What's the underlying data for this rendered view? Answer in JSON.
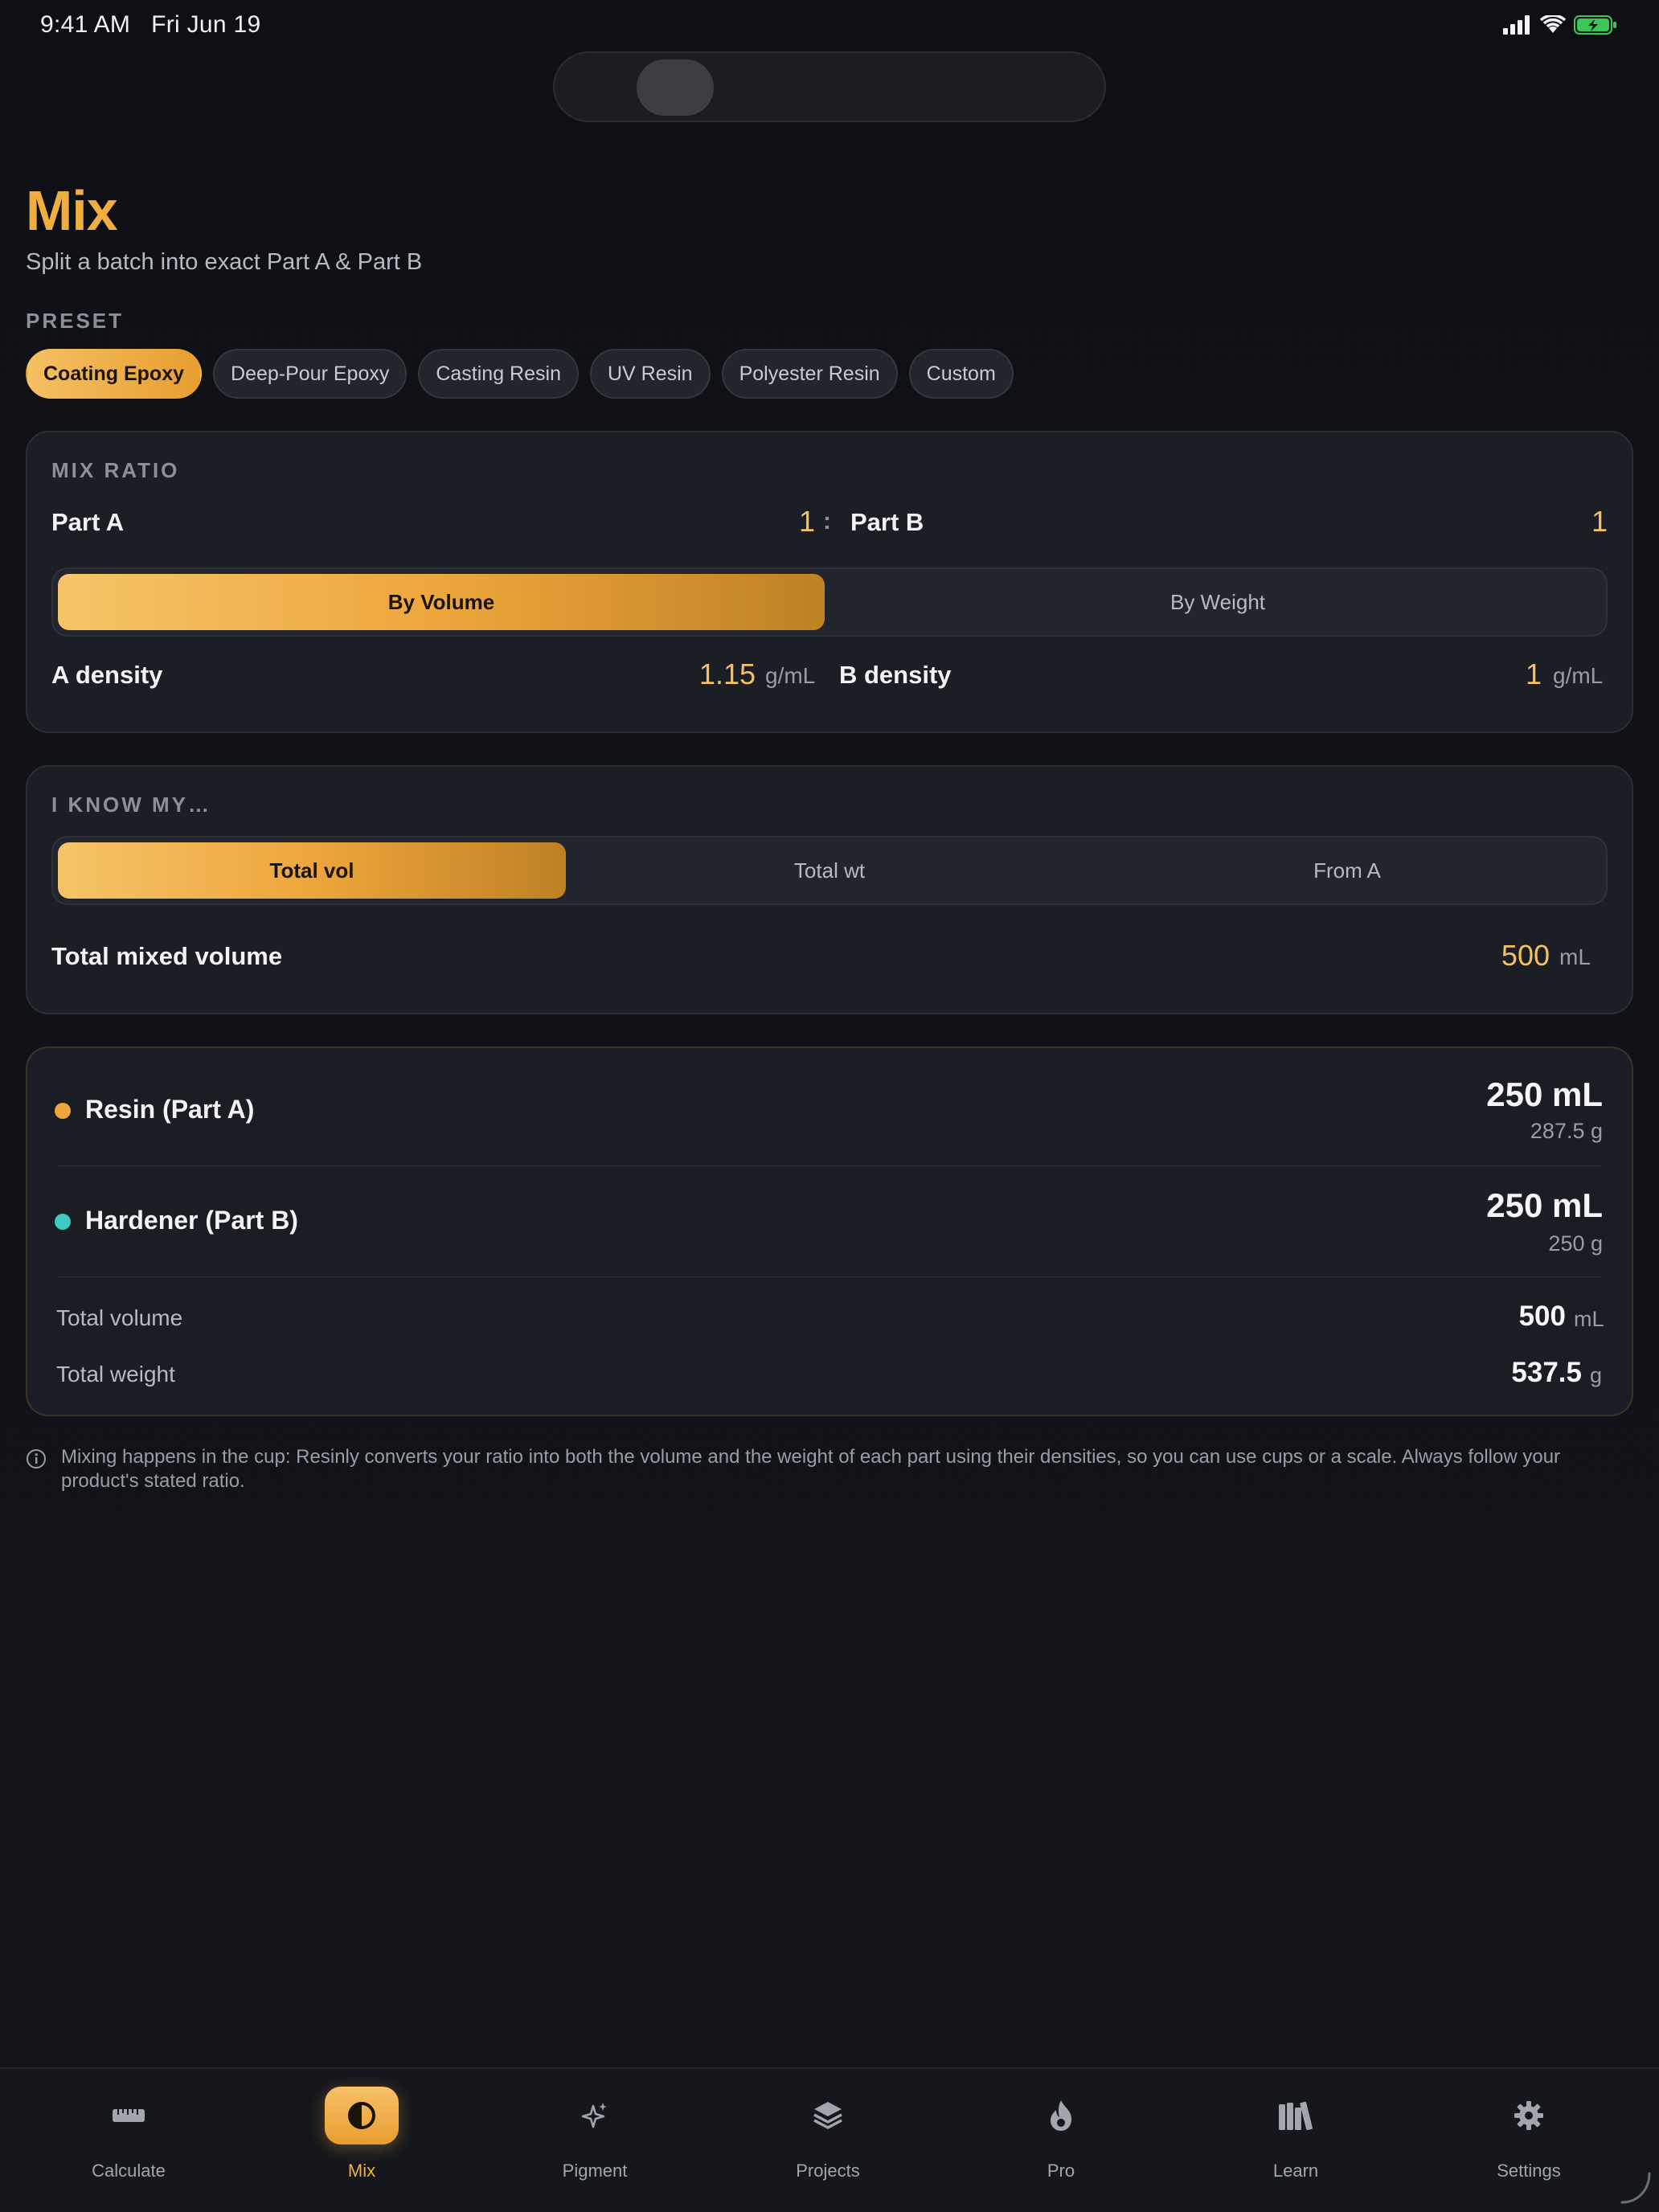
{
  "status": {
    "time": "9:41 AM",
    "date": "Fri Jun 19"
  },
  "header": {
    "title": "Mix",
    "subtitle": "Split a batch into exact Part A & Part B"
  },
  "preset": {
    "label": "PRESET",
    "items": [
      "Coating Epoxy",
      "Deep-Pour Epoxy",
      "Casting Resin",
      "UV Resin",
      "Polyester Resin",
      "Custom"
    ],
    "selected": "Coating Epoxy"
  },
  "mix_ratio": {
    "label": "MIX RATIO",
    "part_a_label": "Part A",
    "part_a_value": "1",
    "separator": ":",
    "part_b_label": "Part B",
    "part_b_value": "1",
    "mode_options": [
      "By Volume",
      "By Weight"
    ],
    "mode_selected": "By Volume",
    "a_density_label": "A density",
    "a_density_value": "1.15",
    "a_density_unit": "g/mL",
    "b_density_label": "B density",
    "b_density_value": "1",
    "b_density_unit": "g/mL"
  },
  "i_know": {
    "label": "I KNOW MY…",
    "options": [
      "Total vol",
      "Total wt",
      "From A"
    ],
    "selected": "Total vol",
    "field_label": "Total mixed volume",
    "field_value": "500",
    "field_unit": "mL"
  },
  "results": {
    "resin": {
      "name": "Resin (Part A)",
      "volume": "250 mL",
      "weight": "287.5 g",
      "color": "#f0a53a"
    },
    "hardener": {
      "name": "Hardener (Part B)",
      "volume": "250 mL",
      "weight": "250 g",
      "color": "#3ec9c1"
    },
    "total_volume_label": "Total volume",
    "total_volume_value": "500",
    "total_volume_unit": "mL",
    "total_weight_label": "Total weight",
    "total_weight_value": "537.5",
    "total_weight_unit": "g"
  },
  "note": "Mixing happens in the cup: Resinly converts your ratio into both the volume and the weight of each part using their densities, so you can use cups or a scale. Always follow your product's stated ratio.",
  "tabs": [
    {
      "label": "Calculate",
      "icon": "ruler-icon"
    },
    {
      "label": "Mix",
      "icon": "half-circle-icon",
      "active": true
    },
    {
      "label": "Pigment",
      "icon": "sparkle-icon"
    },
    {
      "label": "Projects",
      "icon": "layers-icon"
    },
    {
      "label": "Pro",
      "icon": "flame-icon"
    },
    {
      "label": "Learn",
      "icon": "books-icon"
    },
    {
      "label": "Settings",
      "icon": "gear-icon"
    }
  ],
  "colors": {
    "accent": "#f0ae3f",
    "background": "#0f1117",
    "card": "#1c1e25",
    "resin_dot": "#f0a53a",
    "hardener_dot": "#3ec9c1"
  }
}
